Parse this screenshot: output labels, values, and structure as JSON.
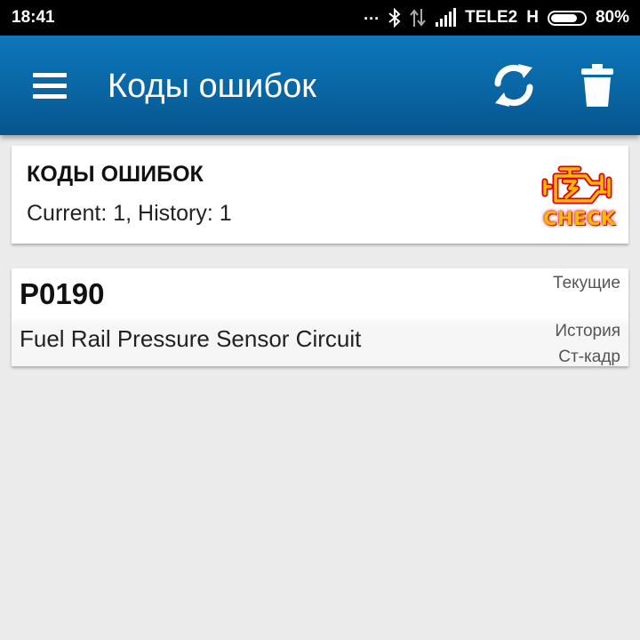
{
  "status_bar": {
    "time": "18:41",
    "dots": "...",
    "icons": [
      "bluetooth-icon",
      "data-transfer-icon",
      "signal-icon"
    ],
    "carrier": "TELE2",
    "network_type": "H",
    "battery_percent": "80%",
    "battery_level": 0.8
  },
  "app_bar": {
    "title": "Коды ошибок",
    "menu_icon": "hamburger-menu-icon",
    "refresh_icon": "refresh-icon",
    "delete_icon": "trash-icon",
    "color": "#0a6aa8"
  },
  "summary": {
    "title": "КОДЫ ОШИБОК",
    "counts": "Current: 1, History: 1",
    "badge_icon": "check-engine-icon",
    "badge_label": "CHECK",
    "badge_color": "#f7b80e"
  },
  "codes": [
    {
      "code": "P0190",
      "description": "Fuel Rail Pressure Sensor Circuit",
      "flags": {
        "current": "Текущие",
        "history": "История",
        "freeze_frame": "Ст-кадр"
      }
    }
  ]
}
